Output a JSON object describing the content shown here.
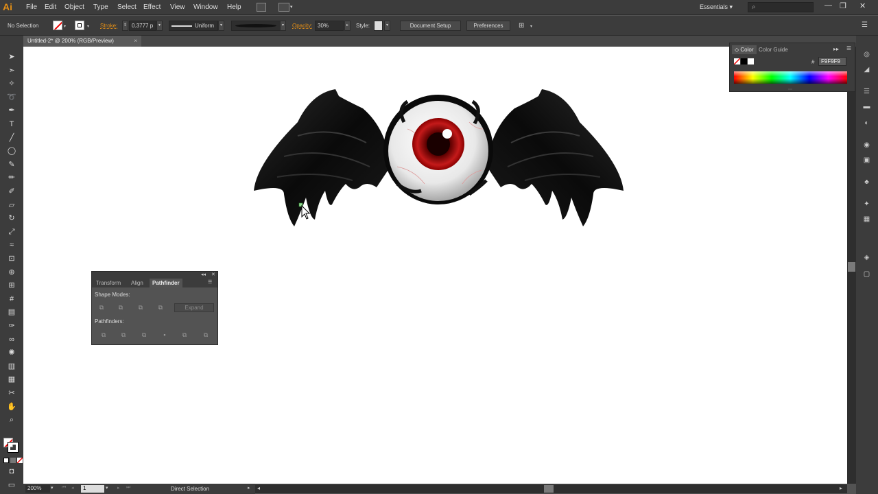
{
  "app": {
    "logo": "Ai",
    "accent": "#e58f15"
  },
  "menu": [
    "File",
    "Edit",
    "Object",
    "Type",
    "Select",
    "Effect",
    "View",
    "Window",
    "Help"
  ],
  "workspace": "Essentials",
  "control": {
    "selection_status": "No Selection",
    "stroke_label": "Stroke:",
    "stroke_weight": "0.3777 p",
    "stroke_profile": "Uniform",
    "opacity_label": "Opacity:",
    "opacity_value": "30%",
    "style_label": "Style:",
    "document_setup": "Document Setup",
    "preferences": "Preferences"
  },
  "document_tab": {
    "title": "Untitled-2* @ 200% (RGB/Preview)",
    "close": "×"
  },
  "color_panel": {
    "tabs": [
      "Color",
      "Color Guide"
    ],
    "hex_symbol": "#",
    "hex_value": "F9F9F9"
  },
  "pathfinder": {
    "tabs": [
      "Transform",
      "Align",
      "Pathfinder"
    ],
    "shape_modes_label": "Shape Modes:",
    "pathfinders_label": "Pathfinders:",
    "expand": "Expand"
  },
  "status": {
    "zoom": "200%",
    "artboard": "1",
    "tool": "Direct Selection"
  },
  "tools": [
    "selection-icon",
    "direct-selection-icon",
    "magic-wand-icon",
    "lasso-icon",
    "pen-icon",
    "type-icon",
    "line-icon",
    "ellipse-icon",
    "paintbrush-icon",
    "pencil-icon",
    "blob-brush-icon",
    "eraser-icon",
    "rotate-icon",
    "scale-icon",
    "width-icon",
    "free-transform-icon",
    "shape-builder-icon",
    "perspective-icon",
    "mesh-icon",
    "gradient-icon",
    "eyedropper-icon",
    "blend-icon",
    "symbol-sprayer-icon",
    "column-graph-icon",
    "artboard-icon",
    "slice-icon",
    "hand-icon",
    "zoom-icon"
  ],
  "dock_icons": [
    "color-icon",
    "color-guide-icon",
    "stroke-icon",
    "gradient-icon",
    "transparency-icon",
    "appearance-icon",
    "graphic-styles-icon",
    "symbols-icon",
    "brushes-icon",
    "swatches-icon",
    "layers-icon",
    "artboards-icon"
  ]
}
